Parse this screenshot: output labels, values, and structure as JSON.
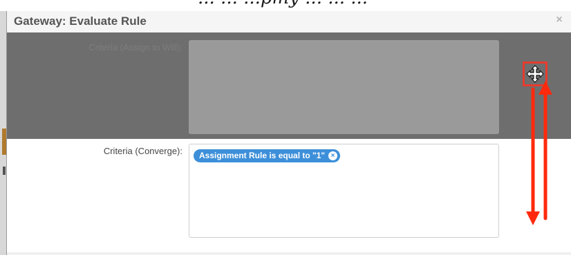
{
  "backdrop": {
    "top_text": "... ... ...pmy ... ... ..."
  },
  "modal": {
    "title": "Gateway: Evaluate Rule",
    "close_icon": "close-icon",
    "close_glyph": "×"
  },
  "fields": {
    "assign_label": "Criteria (Assign to Will):",
    "converge_label": "Criteria (Converge):"
  },
  "criteria_tag": {
    "label": "Assignment Rule is equal to \"1\"",
    "remove_glyph": "×"
  },
  "annotation": {
    "handle_icon": "move-icon",
    "highlight_color": "#e63b2e",
    "arrow_color": "#ff2a0d"
  },
  "colors": {
    "tag_blue": "#3d8fd9",
    "dim_band": "#6e6e6e"
  }
}
